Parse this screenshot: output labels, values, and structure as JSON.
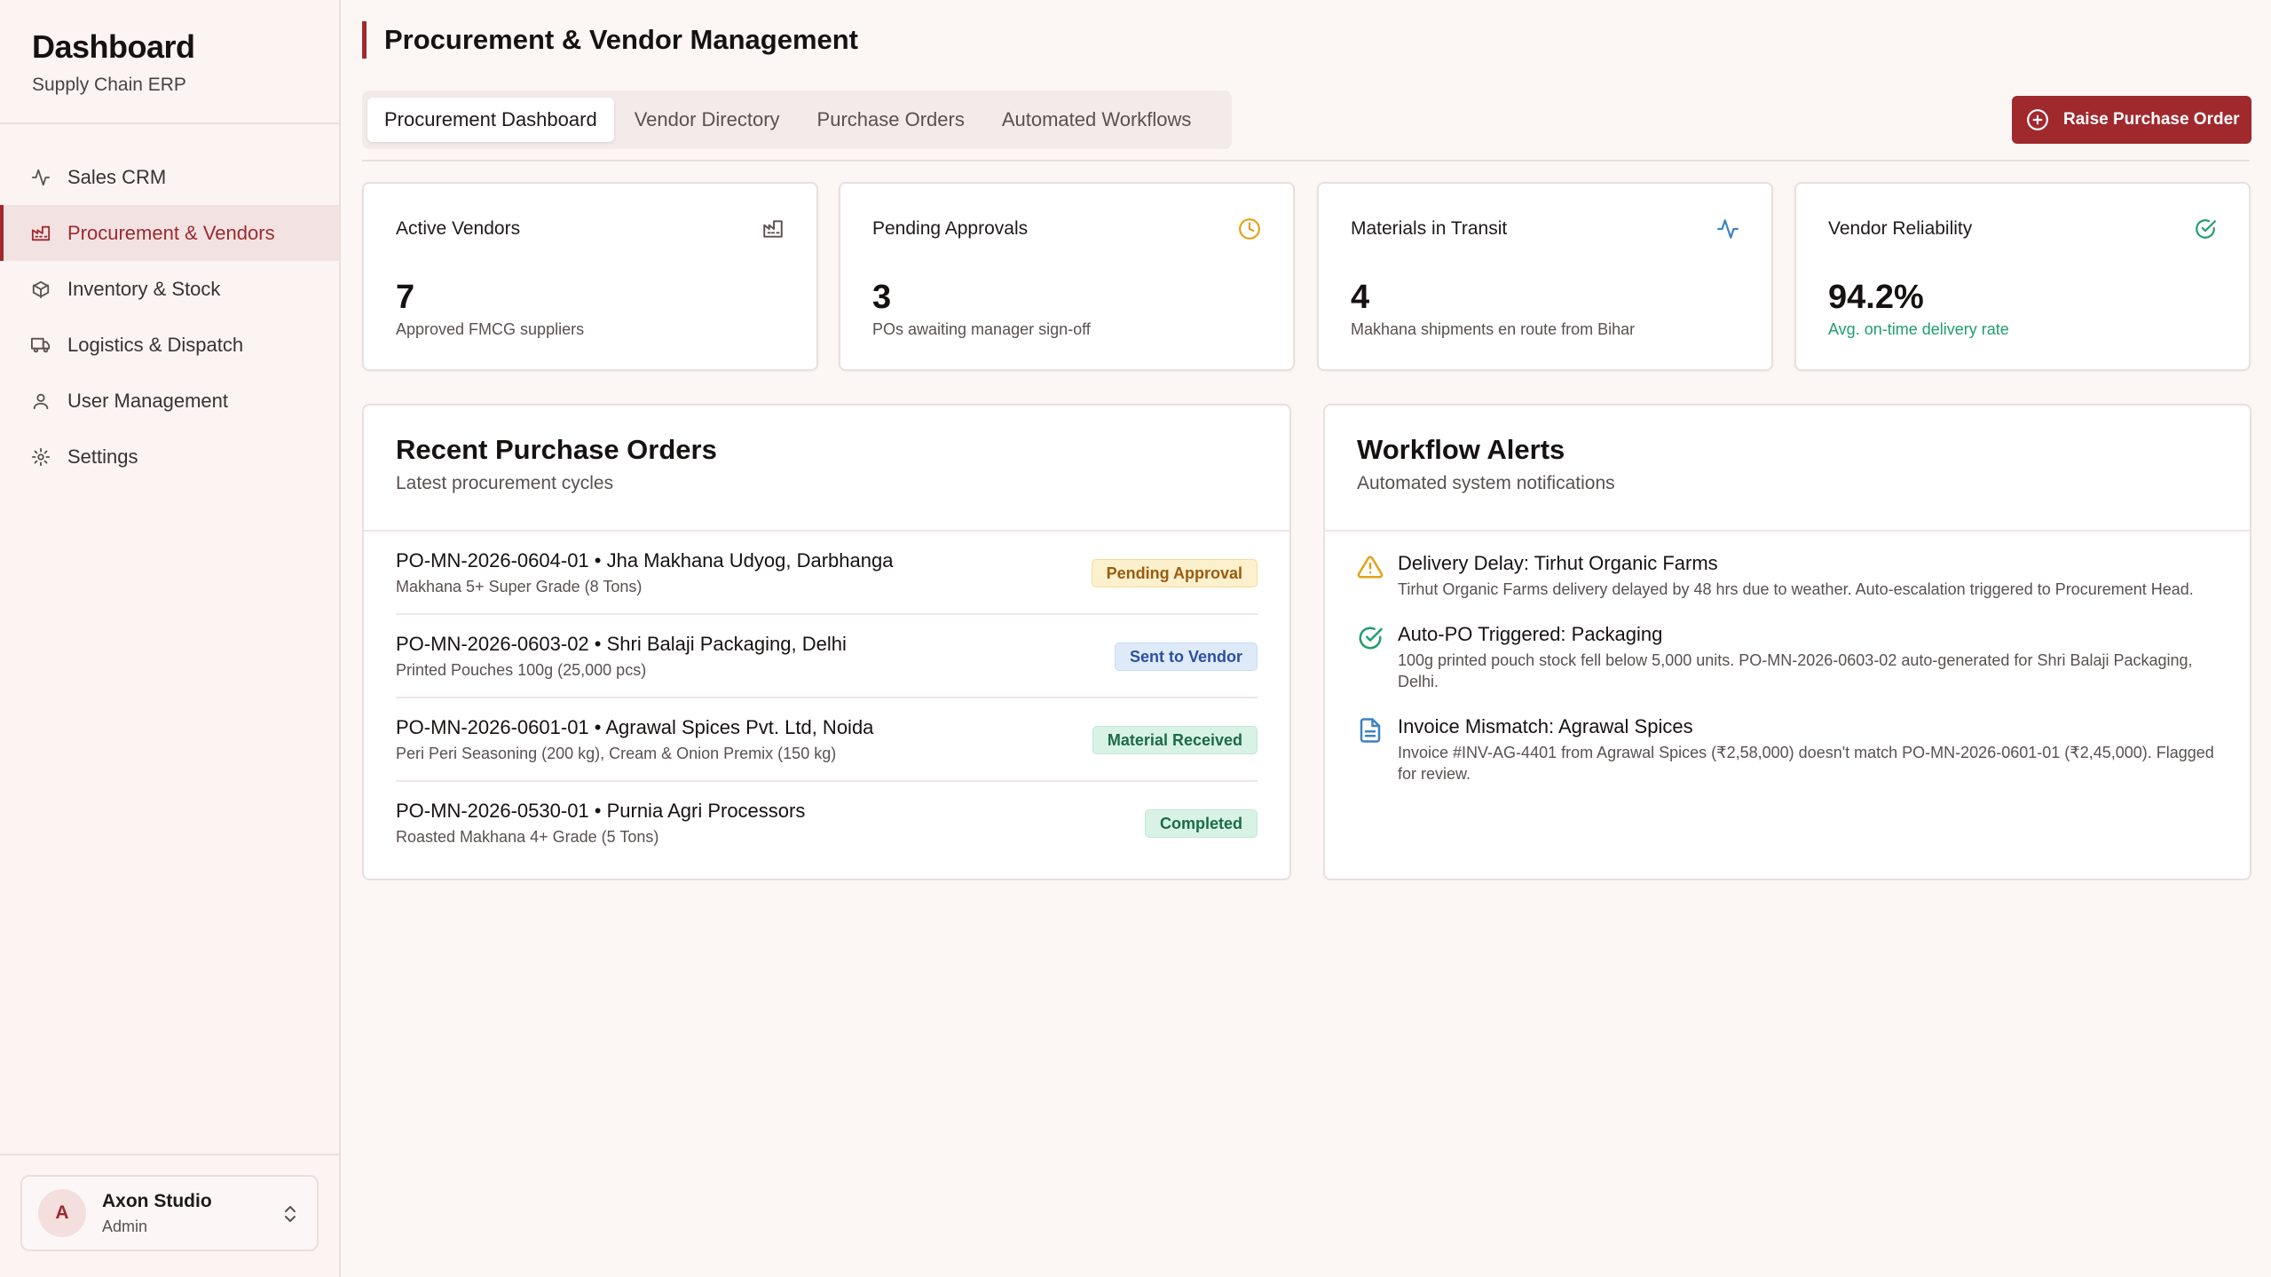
{
  "sidebar": {
    "brand_title": "Dashboard",
    "brand_subtitle": "Supply Chain ERP",
    "items": [
      {
        "label": "Sales CRM",
        "icon": "activity-icon"
      },
      {
        "label": "Procurement & Vendors",
        "icon": "factory-icon"
      },
      {
        "label": "Inventory & Stock",
        "icon": "package-icon"
      },
      {
        "label": "Logistics & Dispatch",
        "icon": "truck-icon"
      },
      {
        "label": "User Management",
        "icon": "user-icon"
      },
      {
        "label": "Settings",
        "icon": "gear-icon"
      }
    ],
    "user": {
      "initial": "A",
      "name": "Axon Studio",
      "role": "Admin"
    }
  },
  "header": {
    "title": "Procurement & Vendor Management",
    "tabs": [
      {
        "label": "Procurement Dashboard"
      },
      {
        "label": "Vendor Directory"
      },
      {
        "label": "Purchase Orders"
      },
      {
        "label": "Automated Workflows"
      }
    ],
    "raise_button": "Raise Purchase Order"
  },
  "stats": [
    {
      "label": "Active Vendors",
      "value": "7",
      "sub": "Approved FMCG suppliers",
      "icon": "factory-icon",
      "color": "#5a5050"
    },
    {
      "label": "Pending Approvals",
      "value": "3",
      "sub": "POs awaiting manager sign-off",
      "icon": "clock-icon",
      "color": "#e3a21a"
    },
    {
      "label": "Materials in Transit",
      "value": "4",
      "sub": "Makhana shipments en route from Bihar",
      "icon": "activity-icon",
      "color": "#3b82c4"
    },
    {
      "label": "Vendor Reliability",
      "value": "94.2%",
      "sub": "Avg. on-time delivery rate",
      "icon": "check-circle-icon",
      "color": "#1f9e6b"
    }
  ],
  "orders": {
    "title": "Recent Purchase Orders",
    "subtitle": "Latest procurement cycles",
    "rows": [
      {
        "title": "PO-MN-2026-0604-01 • Jha Makhana Udyog, Darbhanga",
        "desc": "Makhana 5+ Super Grade (8 Tons)",
        "status": "Pending Approval"
      },
      {
        "title": "PO-MN-2026-0603-02 • Shri Balaji Packaging, Delhi",
        "desc": "Printed Pouches 100g (25,000 pcs)",
        "status": "Sent to Vendor"
      },
      {
        "title": "PO-MN-2026-0601-01 • Agrawal Spices Pvt. Ltd, Noida",
        "desc": "Peri Peri Seasoning (200 kg), Cream & Onion Premix (150 kg)",
        "status": "Material Received"
      },
      {
        "title": "PO-MN-2026-0530-01 • Purnia Agri Processors",
        "desc": "Roasted Makhana 4+ Grade (5 Tons)",
        "status": "Completed"
      }
    ]
  },
  "alerts": {
    "title": "Workflow Alerts",
    "subtitle": "Automated system notifications",
    "items": [
      {
        "title": "Delivery Delay: Tirhut Organic Farms",
        "text": "Tirhut Organic Farms delivery delayed by 48 hrs due to weather. Auto-escalation triggered to Procurement Head.",
        "icon": "warning-icon",
        "color": "#e3a21a"
      },
      {
        "title": "Auto-PO Triggered: Packaging",
        "text": "100g printed pouch stock fell below 5,000 units. PO-MN-2026-0603-02 auto-generated for Shri Balaji Packaging, Delhi.",
        "icon": "check-circle-icon",
        "color": "#1f9e6b"
      },
      {
        "title": "Invoice Mismatch: Agrawal Spices",
        "text": "Invoice #INV-AG-4401 from Agrawal Spices (₹2,58,000) doesn't match PO-MN-2026-0601-01 (₹2,45,000). Flagged for review.",
        "icon": "document-icon",
        "color": "#3b82c4"
      }
    ]
  },
  "colors": {
    "accent": "#a0292e",
    "background": "#fcf6f5"
  }
}
